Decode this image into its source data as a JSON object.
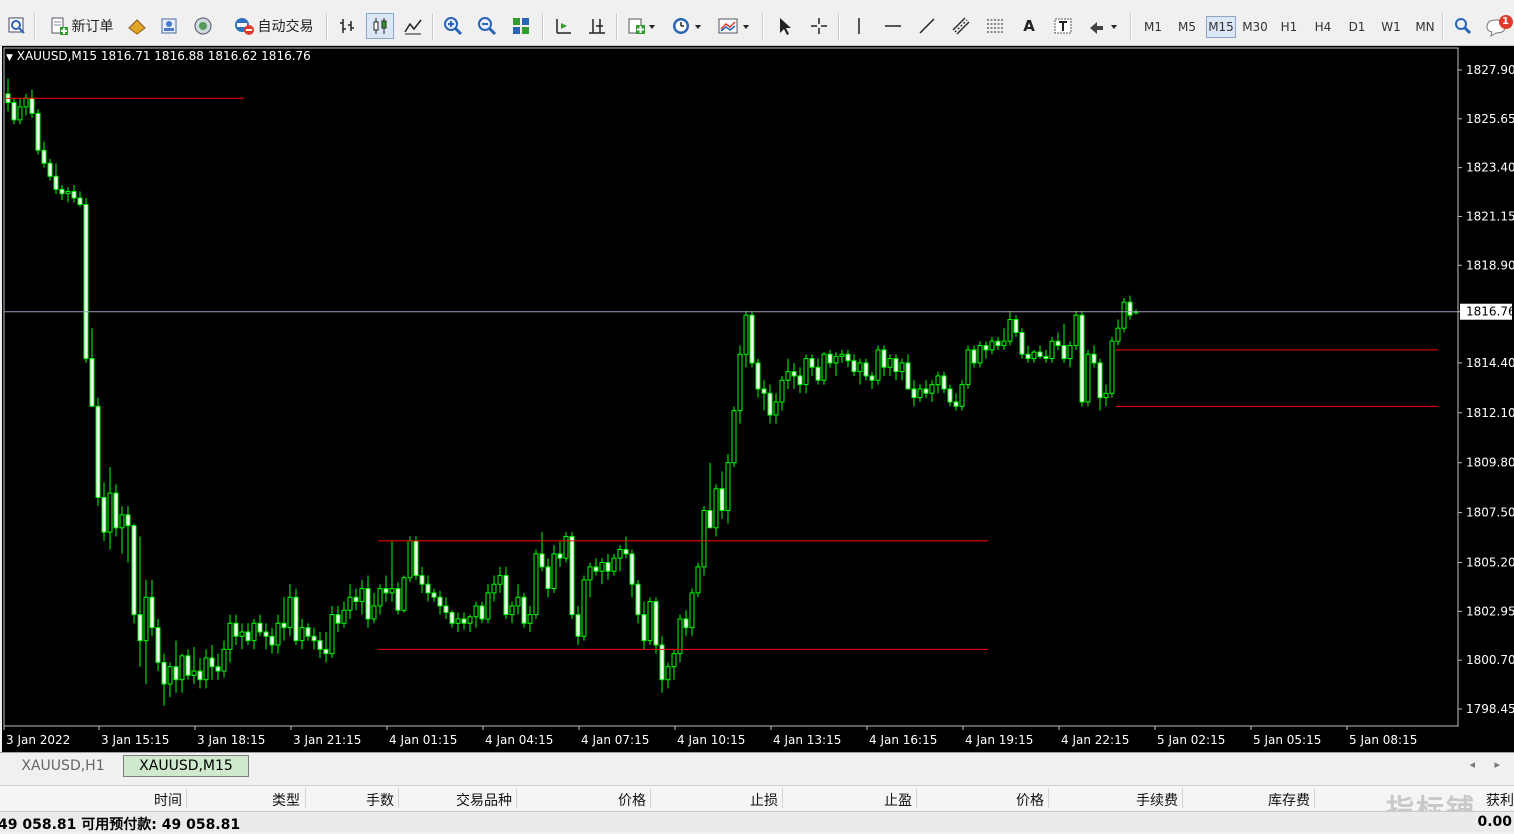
{
  "toolbar": {
    "new_order_label": "新订单",
    "auto_trading_label": "自动交易",
    "timeframes": [
      "M1",
      "M5",
      "M15",
      "M30",
      "H1",
      "H4",
      "D1",
      "W1",
      "MN"
    ],
    "active_timeframe": "M15",
    "notification_count": "1"
  },
  "chart": {
    "symbol_header": "XAUUSD,M15  1816.71 1816.88 1816.62 1816.76",
    "current_price_label": "1816.76",
    "background": "#000000",
    "bull_color": "#00ff00",
    "bear_color": "#ffffff",
    "level_line_color": "#ff0000",
    "price_line_color": "#9aa0b8"
  },
  "chart_data": {
    "type": "candlestick",
    "symbol": "XAUUSD",
    "timeframe": "M15",
    "last_bar": {
      "open": 1816.71,
      "high": 1816.88,
      "low": 1816.62,
      "close": 1816.76
    },
    "y_ticks": [
      "1827.90",
      "1825.65",
      "1823.40",
      "1821.15",
      "1818.90",
      "1816.76",
      "1814.40",
      "1812.10",
      "1809.80",
      "1807.50",
      "1805.20",
      "1802.95",
      "1800.70",
      "1798.45"
    ],
    "x_ticks": [
      "3 Jan 2022",
      "3 Jan 15:15",
      "3 Jan 18:15",
      "3 Jan 21:15",
      "4 Jan 01:15",
      "4 Jan 04:15",
      "4 Jan 07:15",
      "4 Jan 10:15",
      "4 Jan 13:15",
      "4 Jan 16:15",
      "4 Jan 19:15",
      "4 Jan 22:15",
      "5 Jan 02:15",
      "5 Jan 05:15",
      "5 Jan 08:15"
    ],
    "ylim": [
      1797.6,
      1828.7
    ],
    "candles": [
      [
        1826.8,
        1827.5,
        1826.0,
        1826.4
      ],
      [
        1826.4,
        1826.6,
        1825.4,
        1825.6
      ],
      [
        1825.6,
        1826.6,
        1825.4,
        1826.2
      ],
      [
        1826.2,
        1826.8,
        1825.8,
        1826.6
      ],
      [
        1826.6,
        1827.0,
        1825.7,
        1825.9
      ],
      [
        1825.9,
        1826.1,
        1824.0,
        1824.2
      ],
      [
        1824.2,
        1824.6,
        1823.4,
        1823.6
      ],
      [
        1823.6,
        1823.8,
        1822.8,
        1823.0
      ],
      [
        1823.0,
        1823.6,
        1822.2,
        1822.4
      ],
      [
        1822.4,
        1822.6,
        1821.9,
        1822.2
      ],
      [
        1822.2,
        1822.5,
        1821.8,
        1822.3
      ],
      [
        1822.3,
        1822.6,
        1821.8,
        1822.0
      ],
      [
        1822.0,
        1822.3,
        1821.6,
        1821.7
      ],
      [
        1821.7,
        1822.0,
        1814.4,
        1814.6
      ],
      [
        1814.6,
        1816.0,
        1812.6,
        1812.4
      ],
      [
        1812.4,
        1812.8,
        1807.8,
        1808.2
      ],
      [
        1808.2,
        1808.9,
        1806.2,
        1806.6
      ],
      [
        1806.6,
        1809.6,
        1805.8,
        1808.4
      ],
      [
        1808.4,
        1808.8,
        1806.4,
        1806.8
      ],
      [
        1806.8,
        1807.8,
        1805.6,
        1807.4
      ],
      [
        1807.4,
        1807.8,
        1805.2,
        1806.9
      ],
      [
        1806.9,
        1807.0,
        1802.4,
        1802.8
      ],
      [
        1802.8,
        1806.4,
        1800.4,
        1801.6
      ],
      [
        1801.6,
        1804.4,
        1799.6,
        1803.6
      ],
      [
        1803.6,
        1804.4,
        1801.8,
        1802.2
      ],
      [
        1802.2,
        1802.6,
        1800.2,
        1800.6
      ],
      [
        1800.6,
        1801.0,
        1798.6,
        1799.6
      ],
      [
        1799.6,
        1800.6,
        1799.0,
        1800.4
      ],
      [
        1800.4,
        1801.6,
        1799.2,
        1799.8
      ],
      [
        1799.8,
        1801.0,
        1799.2,
        1800.9
      ],
      [
        1800.9,
        1801.2,
        1799.8,
        1800.0
      ],
      [
        1800.0,
        1801.3,
        1799.6,
        1800.2
      ],
      [
        1800.2,
        1800.8,
        1799.4,
        1799.8
      ],
      [
        1799.8,
        1801.2,
        1799.4,
        1800.8
      ],
      [
        1800.8,
        1801.4,
        1799.8,
        1800.4
      ],
      [
        1800.4,
        1801.0,
        1799.8,
        1800.2
      ],
      [
        1800.2,
        1801.6,
        1799.9,
        1801.2
      ],
      [
        1801.2,
        1802.8,
        1800.6,
        1802.4
      ],
      [
        1802.4,
        1802.8,
        1801.4,
        1801.8
      ],
      [
        1801.8,
        1802.4,
        1801.2,
        1802.0
      ],
      [
        1802.0,
        1802.4,
        1801.4,
        1801.6
      ],
      [
        1801.6,
        1802.6,
        1801.2,
        1802.4
      ],
      [
        1802.4,
        1802.8,
        1801.8,
        1802.0
      ],
      [
        1802.0,
        1802.4,
        1801.2,
        1801.8
      ],
      [
        1801.8,
        1802.2,
        1801.0,
        1801.4
      ],
      [
        1801.4,
        1802.8,
        1801.0,
        1802.4
      ],
      [
        1802.4,
        1803.6,
        1801.6,
        1802.2
      ],
      [
        1802.2,
        1804.2,
        1801.8,
        1803.6
      ],
      [
        1803.6,
        1804.0,
        1801.4,
        1801.6
      ],
      [
        1801.6,
        1802.6,
        1801.2,
        1802.2
      ],
      [
        1802.2,
        1802.4,
        1801.6,
        1801.8
      ],
      [
        1801.8,
        1802.2,
        1801.2,
        1801.6
      ],
      [
        1801.6,
        1802.0,
        1800.8,
        1801.2
      ],
      [
        1801.2,
        1802.0,
        1800.6,
        1801.0
      ],
      [
        1801.0,
        1803.2,
        1800.8,
        1802.8
      ],
      [
        1802.8,
        1803.2,
        1802.0,
        1802.4
      ],
      [
        1802.4,
        1803.4,
        1802.2,
        1803.0
      ],
      [
        1803.0,
        1804.2,
        1802.6,
        1803.6
      ],
      [
        1803.6,
        1804.0,
        1803.0,
        1803.4
      ],
      [
        1803.4,
        1804.4,
        1802.8,
        1804.0
      ],
      [
        1804.0,
        1804.6,
        1802.2,
        1802.6
      ],
      [
        1802.6,
        1803.8,
        1802.4,
        1803.2
      ],
      [
        1803.2,
        1804.2,
        1802.8,
        1804.0
      ],
      [
        1804.0,
        1804.6,
        1803.4,
        1803.8
      ],
      [
        1803.8,
        1806.2,
        1803.4,
        1804.0
      ],
      [
        1804.0,
        1804.3,
        1802.8,
        1803.0
      ],
      [
        1803.0,
        1804.6,
        1802.9,
        1804.5
      ],
      [
        1804.5,
        1806.4,
        1804.3,
        1806.2
      ],
      [
        1806.2,
        1806.4,
        1804.4,
        1804.6
      ],
      [
        1804.6,
        1805.0,
        1803.8,
        1804.2
      ],
      [
        1804.2,
        1804.6,
        1803.4,
        1803.8
      ],
      [
        1803.8,
        1804.0,
        1803.4,
        1803.6
      ],
      [
        1803.6,
        1803.9,
        1802.8,
        1803.2
      ],
      [
        1803.2,
        1803.6,
        1802.6,
        1802.9
      ],
      [
        1802.9,
        1803.0,
        1802.2,
        1802.4
      ],
      [
        1802.4,
        1802.9,
        1802.0,
        1802.6
      ],
      [
        1802.6,
        1802.9,
        1802.1,
        1802.4
      ],
      [
        1802.4,
        1802.8,
        1802.0,
        1802.7
      ],
      [
        1802.7,
        1803.4,
        1802.2,
        1803.2
      ],
      [
        1803.2,
        1803.4,
        1802.4,
        1802.6
      ],
      [
        1802.6,
        1804.2,
        1802.4,
        1803.8
      ],
      [
        1803.8,
        1804.6,
        1803.4,
        1804.2
      ],
      [
        1804.2,
        1805.0,
        1803.8,
        1804.6
      ],
      [
        1804.6,
        1805.0,
        1802.6,
        1802.8
      ],
      [
        1802.8,
        1803.4,
        1802.4,
        1803.2
      ],
      [
        1803.2,
        1804.2,
        1802.8,
        1803.6
      ],
      [
        1803.6,
        1803.8,
        1802.2,
        1802.4
      ],
      [
        1802.4,
        1803.2,
        1802.0,
        1802.8
      ],
      [
        1802.8,
        1805.8,
        1802.6,
        1805.6
      ],
      [
        1805.6,
        1806.6,
        1804.8,
        1805.0
      ],
      [
        1805.0,
        1805.4,
        1803.6,
        1804.0
      ],
      [
        1804.0,
        1806.0,
        1803.8,
        1805.6
      ],
      [
        1805.6,
        1806.2,
        1805.0,
        1805.4
      ],
      [
        1805.4,
        1806.6,
        1805.2,
        1806.4
      ],
      [
        1806.4,
        1806.6,
        1802.6,
        1802.8
      ],
      [
        1802.8,
        1803.2,
        1801.4,
        1801.8
      ],
      [
        1801.8,
        1804.6,
        1801.6,
        1804.4
      ],
      [
        1804.4,
        1805.2,
        1803.6,
        1805.0
      ],
      [
        1805.0,
        1805.4,
        1804.6,
        1804.8
      ],
      [
        1804.8,
        1805.4,
        1804.2,
        1805.2
      ],
      [
        1805.2,
        1805.6,
        1804.4,
        1804.8
      ],
      [
        1804.8,
        1805.6,
        1804.6,
        1805.4
      ],
      [
        1805.4,
        1806.0,
        1804.8,
        1805.8
      ],
      [
        1805.8,
        1806.4,
        1805.4,
        1805.6
      ],
      [
        1805.6,
        1805.8,
        1803.6,
        1804.2
      ],
      [
        1804.2,
        1804.4,
        1802.4,
        1802.8
      ],
      [
        1802.8,
        1803.4,
        1801.2,
        1801.6
      ],
      [
        1801.6,
        1803.6,
        1801.4,
        1803.4
      ],
      [
        1803.4,
        1803.6,
        1801.0,
        1801.4
      ],
      [
        1801.4,
        1801.8,
        1799.2,
        1799.8
      ],
      [
        1799.8,
        1800.6,
        1799.4,
        1800.4
      ],
      [
        1800.4,
        1801.2,
        1799.8,
        1801.0
      ],
      [
        1801.0,
        1802.8,
        1800.6,
        1802.6
      ],
      [
        1802.6,
        1803.0,
        1801.8,
        1802.2
      ],
      [
        1802.2,
        1804.0,
        1801.8,
        1803.8
      ],
      [
        1803.8,
        1805.2,
        1803.6,
        1805.0
      ],
      [
        1805.0,
        1807.8,
        1804.6,
        1807.6
      ],
      [
        1807.6,
        1809.8,
        1806.8,
        1806.8
      ],
      [
        1806.8,
        1808.8,
        1806.4,
        1808.6
      ],
      [
        1808.6,
        1809.4,
        1807.2,
        1807.6
      ],
      [
        1807.6,
        1810.2,
        1807.0,
        1809.8
      ],
      [
        1809.8,
        1812.4,
        1809.6,
        1812.2
      ],
      [
        1812.2,
        1815.2,
        1811.6,
        1814.8
      ],
      [
        1814.8,
        1816.8,
        1814.2,
        1816.6
      ],
      [
        1816.6,
        1816.8,
        1814.2,
        1814.4
      ],
      [
        1814.4,
        1814.6,
        1812.8,
        1813.2
      ],
      [
        1813.2,
        1813.6,
        1812.2,
        1813.0
      ],
      [
        1813.0,
        1813.4,
        1811.6,
        1812.0
      ],
      [
        1812.0,
        1813.0,
        1811.6,
        1812.6
      ],
      [
        1812.6,
        1813.8,
        1812.2,
        1813.6
      ],
      [
        1813.6,
        1814.6,
        1813.2,
        1814.0
      ],
      [
        1814.0,
        1814.4,
        1813.2,
        1813.8
      ],
      [
        1813.8,
        1814.2,
        1813.0,
        1813.4
      ],
      [
        1813.4,
        1814.8,
        1813.0,
        1814.6
      ],
      [
        1814.6,
        1814.8,
        1813.8,
        1814.2
      ],
      [
        1814.2,
        1814.6,
        1813.4,
        1813.6
      ],
      [
        1813.6,
        1814.9,
        1813.4,
        1814.8
      ],
      [
        1814.8,
        1815.0,
        1814.2,
        1814.4
      ],
      [
        1814.4,
        1814.9,
        1813.8,
        1814.7
      ],
      [
        1814.7,
        1815.0,
        1814.4,
        1814.8
      ],
      [
        1814.8,
        1815.0,
        1814.2,
        1814.5
      ],
      [
        1814.5,
        1814.8,
        1813.8,
        1814.0
      ],
      [
        1814.0,
        1814.6,
        1813.4,
        1814.4
      ],
      [
        1814.4,
        1814.6,
        1813.6,
        1813.8
      ],
      [
        1813.8,
        1814.0,
        1813.2,
        1813.6
      ],
      [
        1813.6,
        1815.2,
        1813.4,
        1815.0
      ],
      [
        1815.0,
        1815.2,
        1813.8,
        1814.2
      ],
      [
        1814.2,
        1814.8,
        1813.8,
        1814.6
      ],
      [
        1814.6,
        1814.8,
        1813.6,
        1814.0
      ],
      [
        1814.0,
        1814.6,
        1813.6,
        1814.4
      ],
      [
        1814.4,
        1814.8,
        1813.2,
        1813.2
      ],
      [
        1813.2,
        1813.6,
        1812.4,
        1812.8
      ],
      [
        1812.8,
        1813.4,
        1812.6,
        1813.2
      ],
      [
        1813.2,
        1813.6,
        1812.8,
        1813.0
      ],
      [
        1813.0,
        1813.6,
        1812.6,
        1813.4
      ],
      [
        1813.4,
        1814.0,
        1813.0,
        1813.8
      ],
      [
        1813.8,
        1814.0,
        1813.0,
        1813.2
      ],
      [
        1813.2,
        1813.4,
        1812.4,
        1812.6
      ],
      [
        1812.6,
        1813.0,
        1812.2,
        1812.4
      ],
      [
        1812.4,
        1813.6,
        1812.2,
        1813.4
      ],
      [
        1813.4,
        1815.2,
        1813.2,
        1815.0
      ],
      [
        1815.0,
        1815.2,
        1814.2,
        1814.4
      ],
      [
        1814.4,
        1815.4,
        1814.2,
        1815.2
      ],
      [
        1815.2,
        1815.4,
        1814.6,
        1815.0
      ],
      [
        1815.0,
        1815.6,
        1814.8,
        1815.4
      ],
      [
        1815.4,
        1815.6,
        1815.0,
        1815.2
      ],
      [
        1815.2,
        1816.0,
        1815.0,
        1815.4
      ],
      [
        1815.4,
        1816.8,
        1815.2,
        1816.4
      ],
      [
        1816.4,
        1816.6,
        1815.6,
        1815.8
      ],
      [
        1815.8,
        1816.0,
        1814.6,
        1814.8
      ],
      [
        1814.8,
        1815.2,
        1814.4,
        1814.6
      ],
      [
        1814.6,
        1815.0,
        1814.4,
        1814.9
      ],
      [
        1814.9,
        1815.2,
        1814.6,
        1814.7
      ],
      [
        1814.7,
        1815.0,
        1814.4,
        1814.6
      ],
      [
        1814.6,
        1815.6,
        1814.4,
        1815.4
      ],
      [
        1815.4,
        1815.8,
        1815.0,
        1815.2
      ],
      [
        1815.2,
        1816.2,
        1814.4,
        1814.6
      ],
      [
        1814.6,
        1815.4,
        1814.2,
        1815.2
      ],
      [
        1815.2,
        1816.8,
        1815.0,
        1816.6
      ],
      [
        1816.6,
        1816.8,
        1812.4,
        1812.6
      ],
      [
        1812.6,
        1815.0,
        1812.4,
        1814.8
      ],
      [
        1814.8,
        1815.2,
        1814.2,
        1814.4
      ],
      [
        1814.4,
        1814.6,
        1812.2,
        1812.8
      ],
      [
        1812.8,
        1813.4,
        1812.4,
        1813.0
      ],
      [
        1813.0,
        1815.6,
        1812.8,
        1815.4
      ],
      [
        1815.4,
        1816.4,
        1815.2,
        1816.0
      ],
      [
        1816.0,
        1817.4,
        1815.8,
        1817.2
      ],
      [
        1817.2,
        1817.5,
        1816.4,
        1816.6
      ],
      [
        1816.71,
        1816.88,
        1816.62,
        1816.76
      ]
    ],
    "horizontal_levels": [
      {
        "price": 1826.6,
        "from": 0,
        "to": 39
      },
      {
        "price": 1806.2,
        "from": 62,
        "to": 163
      },
      {
        "price": 1801.2,
        "from": 62,
        "to": 163
      },
      {
        "price": 1815.0,
        "from": 185,
        "to": 238
      },
      {
        "price": 1812.4,
        "from": 185,
        "to": 238
      }
    ]
  },
  "tabs": [
    {
      "label": "XAUUSD,H1",
      "active": false
    },
    {
      "label": "XAUUSD,M15",
      "active": true
    }
  ],
  "table_headers": [
    "时间",
    "类型",
    "手数",
    "交易品种",
    "价格",
    "止损",
    "止盈",
    "价格",
    "手续费",
    "库存费",
    "获利"
  ],
  "account": {
    "balance_text": "49 058.81  可用预付款: 49 058.81",
    "profit_text": "0.00"
  },
  "watermark": "指标铺"
}
